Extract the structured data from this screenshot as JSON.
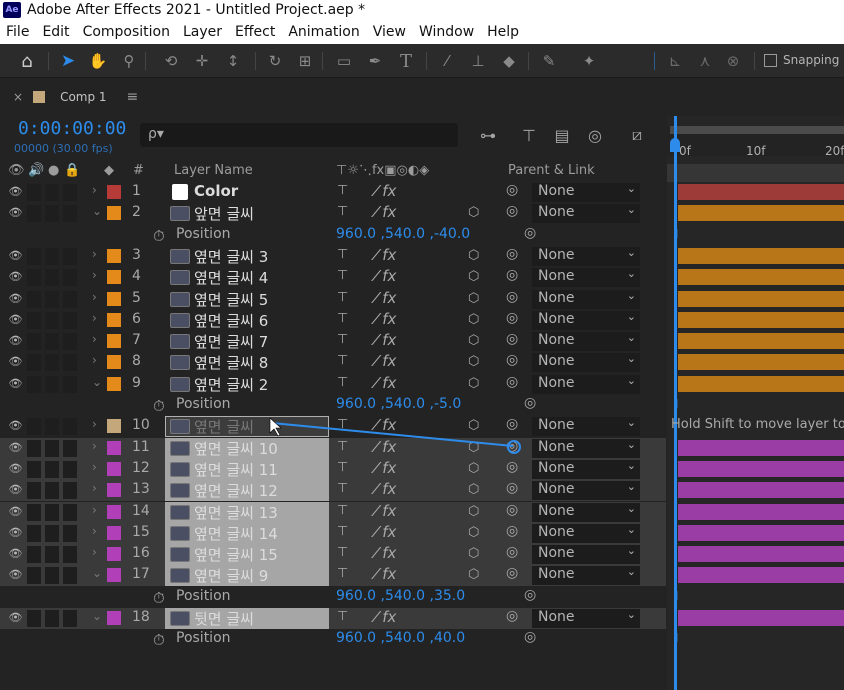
{
  "window": {
    "title": "Adobe After Effects 2021 - Untitled Project.aep *"
  },
  "menu": [
    "File",
    "Edit",
    "Composition",
    "Layer",
    "Effect",
    "Animation",
    "View",
    "Window",
    "Help"
  ],
  "toolbar": {
    "snapping_label": "Snapping",
    "tools": [
      "home-icon",
      "selection-icon",
      "hand-icon",
      "zoom-icon",
      "orbit-icon",
      "move-icon",
      "dolly-icon",
      "rotate-icon",
      "anchor-icon",
      "rectangle-icon",
      "pen-icon",
      "type-icon",
      "brush-icon",
      "stamp-icon",
      "eraser-icon",
      "roto-icon",
      "puppet-icon"
    ]
  },
  "comp": {
    "tab_name": "Comp 1",
    "timecode": "0:00:00:00",
    "fps_text": "00000 (30.00 fps)",
    "search_placeholder": "ρ▾"
  },
  "columns": {
    "label_icon": "tag-icon",
    "hash": "#",
    "layer_name": "Layer Name",
    "parent_link": "Parent & Link"
  },
  "rows": [
    {
      "kind": "layer",
      "num": "1",
      "name": "Color",
      "label_color": "#b63a37",
      "twirl": "›",
      "icon": "solid",
      "three_d": false,
      "parent": "None"
    },
    {
      "kind": "layer",
      "num": "2",
      "name": "앞면 글씨",
      "label_color": "#e38a1b",
      "twirl": "⌄",
      "icon": "precomp",
      "three_d": true,
      "parent": "None"
    },
    {
      "kind": "prop",
      "label": "Position",
      "value": "960.0 ,540.0 ,-40.0"
    },
    {
      "kind": "layer",
      "num": "3",
      "name": "옆면 글씨 3",
      "label_color": "#e38a1b",
      "twirl": "›",
      "icon": "precomp",
      "three_d": true,
      "parent": "None"
    },
    {
      "kind": "layer",
      "num": "4",
      "name": "옆면 글씨 4",
      "label_color": "#e38a1b",
      "twirl": "›",
      "icon": "precomp",
      "three_d": true,
      "parent": "None"
    },
    {
      "kind": "layer",
      "num": "5",
      "name": "옆면 글씨 5",
      "label_color": "#e38a1b",
      "twirl": "›",
      "icon": "precomp",
      "three_d": true,
      "parent": "None"
    },
    {
      "kind": "layer",
      "num": "6",
      "name": "옆면 글씨 6",
      "label_color": "#e38a1b",
      "twirl": "›",
      "icon": "precomp",
      "three_d": true,
      "parent": "None"
    },
    {
      "kind": "layer",
      "num": "7",
      "name": "옆면 글씨 7",
      "label_color": "#e38a1b",
      "twirl": "›",
      "icon": "precomp",
      "three_d": true,
      "parent": "None"
    },
    {
      "kind": "layer",
      "num": "8",
      "name": "옆면 글씨 8",
      "label_color": "#e38a1b",
      "twirl": "›",
      "icon": "precomp",
      "three_d": true,
      "parent": "None"
    },
    {
      "kind": "layer",
      "num": "9",
      "name": "옆면 글씨 2",
      "label_color": "#e38a1b",
      "twirl": "⌄",
      "icon": "precomp",
      "three_d": true,
      "parent": "None"
    },
    {
      "kind": "prop",
      "label": "Position",
      "value": "960.0 ,540.0 ,-5.0"
    },
    {
      "kind": "layer",
      "num": "10",
      "name": "옆면 글씨",
      "label_color": "#c4a77a",
      "twirl": "›",
      "icon": "precomp",
      "three_d": true,
      "parent": "None",
      "dragging": true
    },
    {
      "kind": "layer",
      "num": "11",
      "name": "옆면 글씨 10",
      "label_color": "#b03fb8",
      "twirl": "›",
      "icon": "precomp",
      "three_d": true,
      "parent": "None",
      "selected": true
    },
    {
      "kind": "layer",
      "num": "12",
      "name": "옆면 글씨 11",
      "label_color": "#b03fb8",
      "twirl": "›",
      "icon": "precomp",
      "three_d": true,
      "parent": "None",
      "selected": true
    },
    {
      "kind": "layer",
      "num": "13",
      "name": "옆면 글씨 12",
      "label_color": "#b03fb8",
      "twirl": "›",
      "icon": "precomp",
      "three_d": true,
      "parent": "None",
      "selected": true
    },
    {
      "kind": "layer",
      "num": "14",
      "name": "옆면 글씨 13",
      "label_color": "#b03fb8",
      "twirl": "›",
      "icon": "precomp",
      "three_d": true,
      "parent": "None",
      "selected": true
    },
    {
      "kind": "layer",
      "num": "15",
      "name": "옆면 글씨 14",
      "label_color": "#b03fb8",
      "twirl": "›",
      "icon": "precomp",
      "three_d": true,
      "parent": "None",
      "selected": true
    },
    {
      "kind": "layer",
      "num": "16",
      "name": "옆면 글씨 15",
      "label_color": "#b03fb8",
      "twirl": "›",
      "icon": "precomp",
      "three_d": true,
      "parent": "None",
      "selected": true
    },
    {
      "kind": "layer",
      "num": "17",
      "name": "옆면 글씨 9",
      "label_color": "#b03fb8",
      "twirl": "⌄",
      "icon": "precomp",
      "three_d": true,
      "parent": "None",
      "selected": true
    },
    {
      "kind": "prop",
      "label": "Position",
      "value": "960.0 ,540.0 ,35.0"
    },
    {
      "kind": "layer",
      "num": "18",
      "name": "뒷면 글씨",
      "label_color": "#b03fb8",
      "twirl": "⌄",
      "icon": "precomp",
      "three_d": false,
      "parent": "None",
      "selected": true
    },
    {
      "kind": "prop",
      "label": "Position",
      "value": "960.0 ,540.0 ,40.0"
    }
  ],
  "timeline": {
    "ruler_ticks": [
      "0f",
      "10f",
      "20f"
    ],
    "hint": "Hold Shift to move layer to",
    "bar_colors": {
      "red": "#9c3b38",
      "orange": "#b87619",
      "purple": "#9a3ea6"
    }
  },
  "colors": {
    "accent": "#2d8ceb",
    "panel": "#232323"
  }
}
